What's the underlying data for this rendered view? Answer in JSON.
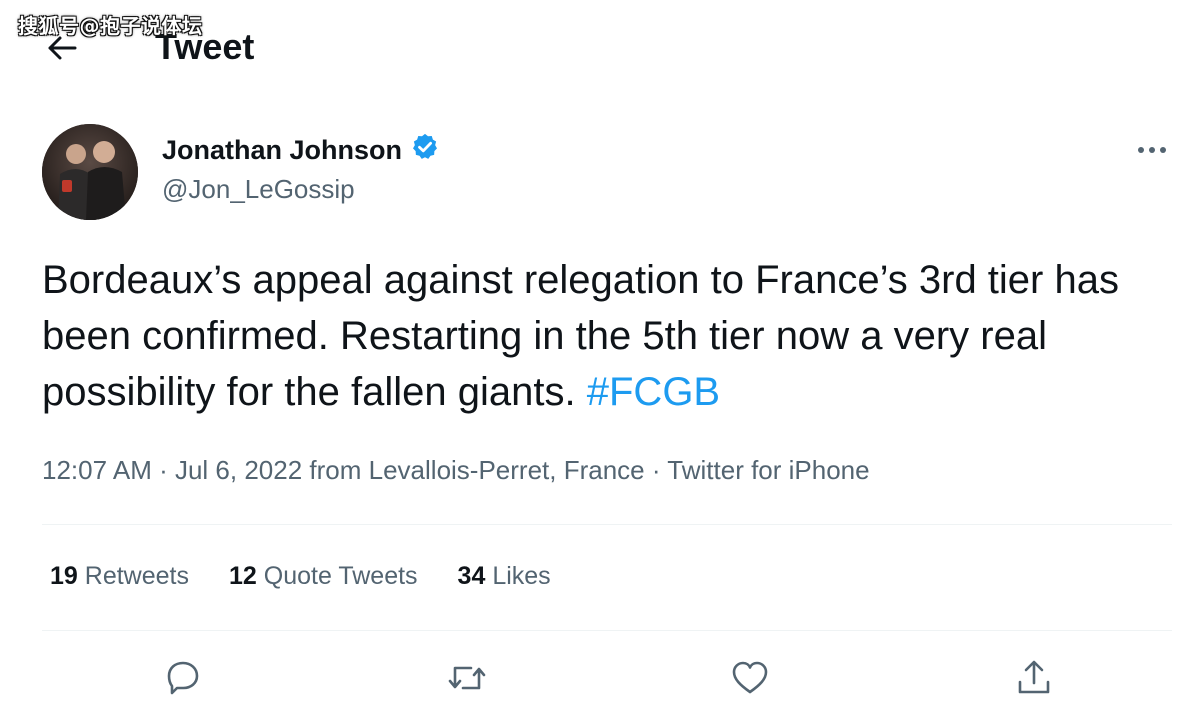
{
  "watermark": "搜狐号@抱子说体坛",
  "header": {
    "back_icon": "arrow-left-icon",
    "title": "Tweet"
  },
  "author": {
    "display_name": "Jonathan Johnson",
    "verified_icon": "verified-badge-icon",
    "handle": "@Jon_LeGossip",
    "more_icon": "more-horizontal-icon"
  },
  "tweet": {
    "text": "Bordeaux’s appeal against relegation to France’s 3rd tier has been confirmed. Restarting in the 5th tier now a very real possibility for the fallen giants.",
    "hashtag": "#FCGB"
  },
  "meta": {
    "time": "12:07 AM",
    "sep": " · ",
    "date": "Jul 6, 2022",
    "location": " from Levallois-Perret, France",
    "source": "Twitter for iPhone"
  },
  "stats": {
    "retweets_count": "19",
    "retweets_label": "Retweets",
    "quotes_count": "12",
    "quotes_label": "Quote Tweets",
    "likes_count": "34",
    "likes_label": "Likes"
  },
  "actions": [
    "reply-icon",
    "retweet-icon",
    "like-icon",
    "share-icon"
  ],
  "colors": {
    "text_primary": "#0f1419",
    "text_secondary": "#536471",
    "accent": "#1d9bf0",
    "divider": "#eff3f4"
  }
}
